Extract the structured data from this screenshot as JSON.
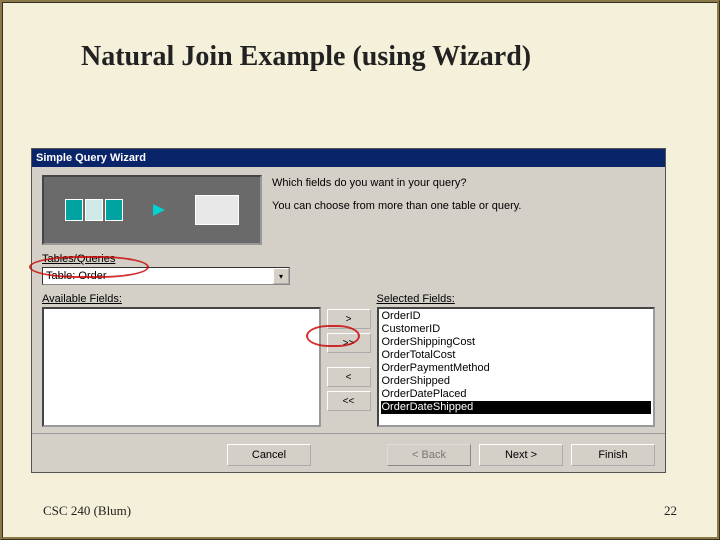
{
  "slide": {
    "title": "Natural Join Example (using Wizard)",
    "footer": "CSC 240 (Blum)",
    "page": "22"
  },
  "wizard": {
    "title": "Simple Query Wizard",
    "instr1": "Which fields do you want in your query?",
    "instr2": "You can choose from more than one table or query.",
    "tables_label": "Tables/Queries",
    "combo_value": "Table: Order",
    "available_label": "Available Fields:",
    "selected_label": "Selected Fields:",
    "move": {
      "add": ">",
      "add_all": ">>",
      "remove": "<",
      "remove_all": "<<"
    },
    "available_fields": [],
    "selected_fields": [
      "OrderID",
      "CustomerID",
      "OrderShippingCost",
      "OrderTotalCost",
      "OrderPaymentMethod",
      "OrderShipped",
      "OrderDatePlaced",
      "OrderDateShipped"
    ],
    "selected_highlight_index": 7,
    "buttons": {
      "cancel": "Cancel",
      "back": "< Back",
      "next": "Next >",
      "finish": "Finish"
    }
  }
}
